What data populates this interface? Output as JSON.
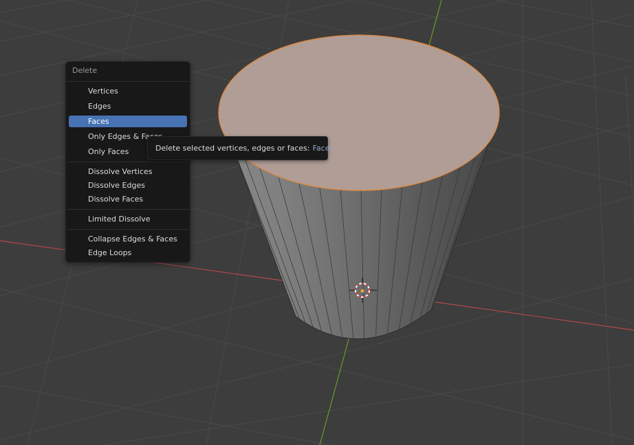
{
  "menu": {
    "title": "Delete",
    "items": [
      {
        "label": "Vertices"
      },
      {
        "label": "Edges"
      },
      {
        "label": "Faces",
        "active": true
      },
      {
        "label": "Only Edges & Faces"
      },
      {
        "label": "Only Faces"
      },
      {
        "label": "Dissolve Vertices"
      },
      {
        "label": "Dissolve Edges"
      },
      {
        "label": "Dissolve Faces"
      },
      {
        "label": "Limited Dissolve"
      },
      {
        "label": "Collapse Edges & Faces"
      },
      {
        "label": "Edge Loops"
      }
    ]
  },
  "tooltip": {
    "text": "Delete selected vertices, edges or faces:",
    "value": "Faces"
  },
  "colors": {
    "background": "#3d3d3d",
    "grid_line": "#4a4a4a",
    "x_axis": "#b34848",
    "y_axis": "#6a9a2a",
    "selected_face": "#b09d96",
    "selection_outline": "#e0883b",
    "menu_highlight": "#4772b3"
  },
  "icons": {
    "cursor": "3d-cursor-icon"
  }
}
